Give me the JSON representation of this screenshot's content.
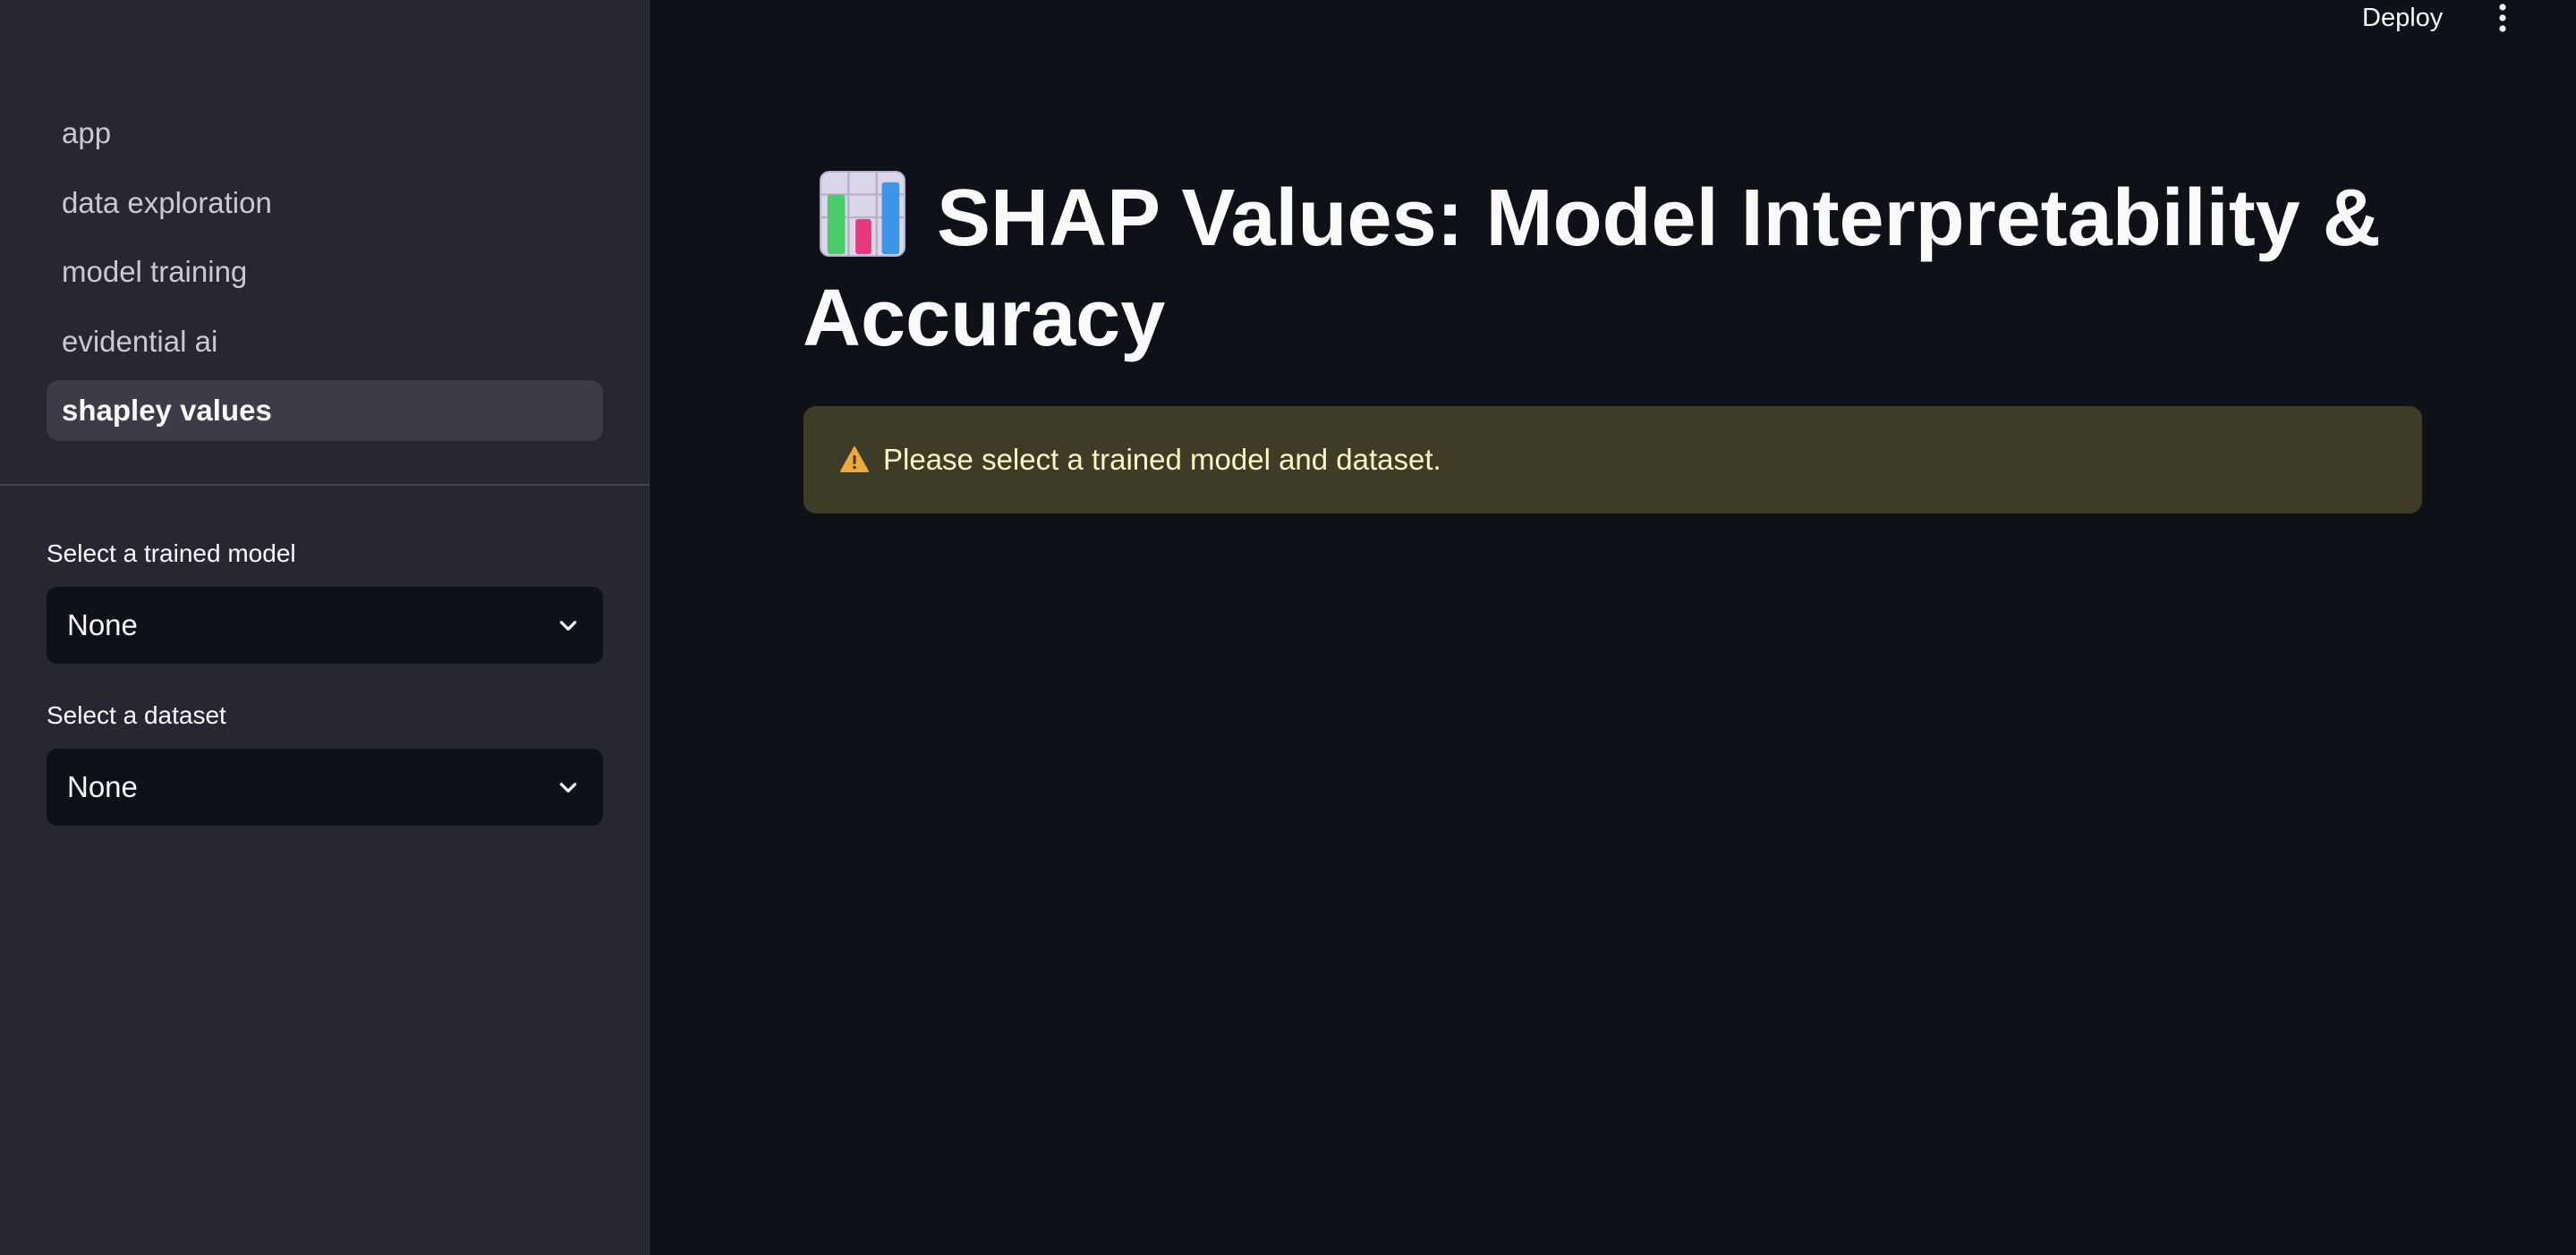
{
  "sidebar": {
    "nav_items": [
      {
        "label": "app"
      },
      {
        "label": "data exploration"
      },
      {
        "label": "model training"
      },
      {
        "label": "evidential ai"
      },
      {
        "label": "shapley values"
      }
    ],
    "active_index": 4,
    "model_select": {
      "label": "Select a trained model",
      "value": "None"
    },
    "dataset_select": {
      "label": "Select a dataset",
      "value": "None"
    }
  },
  "header": {
    "deploy_label": "Deploy",
    "menu_icon": "kebab-menu-icon"
  },
  "main": {
    "title_icon": "bar-chart-emoji-icon",
    "title": "SHAP Values: Model Interpretability & Accuracy",
    "alert": {
      "icon": "warning-icon",
      "text": "Please select a trained model and dataset."
    }
  },
  "colors": {
    "sidebar_bg": "#262730",
    "main_bg": "#0e1117",
    "active_nav_bg": "#3b3c47",
    "alert_bg": "#3e3c26",
    "alert_text": "#fff7c4",
    "warning_icon": "#f0a83a"
  }
}
